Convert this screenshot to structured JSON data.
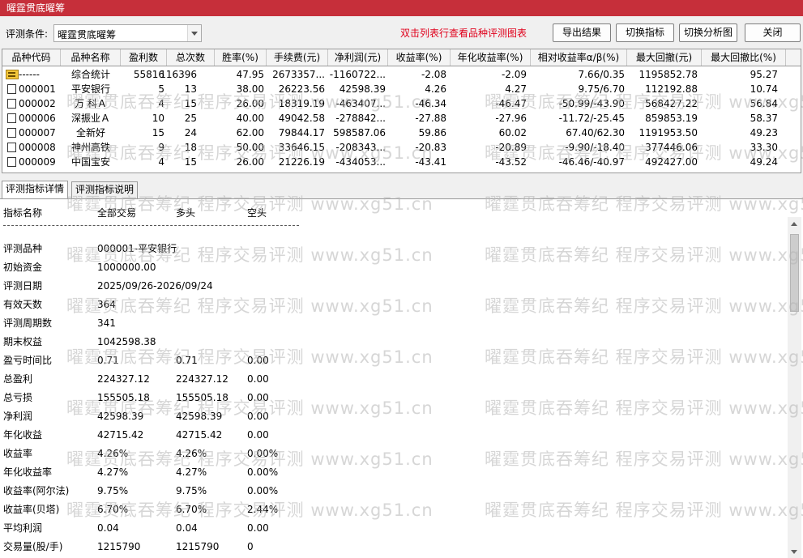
{
  "window": {
    "title": "曜霆贯底曜筹"
  },
  "toolbar": {
    "condition_label": "评测条件:",
    "condition_value": "曜霆贯底曜筹",
    "hint": "双击列表行查看品种评测图表",
    "buttons": {
      "export": "导出结果",
      "switch_indicator": "切换指标",
      "switch_chart": "切换分析图",
      "close": "关闭"
    }
  },
  "table": {
    "columns": [
      "品种代码",
      "品种名称",
      "盈利数",
      "总次数",
      "胜率(%)",
      "手续费(元)",
      "净利润(元)",
      "收益率(%)",
      "年化收益率(%)",
      "相对收益率α/β(%)",
      "最大回撤(元)",
      "最大回撤比(%)"
    ],
    "rows": [
      {
        "code": "------",
        "name": "综合统计",
        "win": "55816",
        "total": "116396",
        "rate": "47.95",
        "fee": "2673357...",
        "profit": "-1160722...",
        "ret": "-2.08",
        "annual": "-2.09",
        "rel": "7.66/0.35",
        "dd": "1195852.78",
        "ddr": "95.27",
        "icon": "folder"
      },
      {
        "code": "000001",
        "name": "平安银行",
        "win": "5",
        "total": "13",
        "rate": "38.00",
        "fee": "26223.56",
        "profit": "42598.39",
        "ret": "4.26",
        "annual": "4.27",
        "rel": "9.75/6.70",
        "dd": "112192.88",
        "ddr": "10.74",
        "icon": "doc"
      },
      {
        "code": "000002",
        "name": "万 科Ａ",
        "win": "4",
        "total": "15",
        "rate": "26.00",
        "fee": "18319.19",
        "profit": "-463407...",
        "ret": "-46.34",
        "annual": "-46.47",
        "rel": "-50.99/-43.90",
        "dd": "568427.22",
        "ddr": "56.84",
        "icon": "doc"
      },
      {
        "code": "000006",
        "name": "深振业Ａ",
        "win": "10",
        "total": "25",
        "rate": "40.00",
        "fee": "49042.58",
        "profit": "-278842...",
        "ret": "-27.88",
        "annual": "-27.96",
        "rel": "-11.72/-25.45",
        "dd": "859853.19",
        "ddr": "58.37",
        "icon": "doc"
      },
      {
        "code": "000007",
        "name": "全新好",
        "win": "15",
        "total": "24",
        "rate": "62.00",
        "fee": "79844.17",
        "profit": "598587.06",
        "ret": "59.86",
        "annual": "60.02",
        "rel": "67.40/62.30",
        "dd": "1191953.50",
        "ddr": "49.23",
        "icon": "doc"
      },
      {
        "code": "000008",
        "name": "神州高铁",
        "win": "9",
        "total": "18",
        "rate": "50.00",
        "fee": "33646.15",
        "profit": "-208343...",
        "ret": "-20.83",
        "annual": "-20.89",
        "rel": "-9.90/-18.40",
        "dd": "377446.06",
        "ddr": "33.30",
        "icon": "doc"
      },
      {
        "code": "000009",
        "name": "中国宝安",
        "win": "4",
        "total": "15",
        "rate": "26.00",
        "fee": "21226.19",
        "profit": "-434053...",
        "ret": "-43.41",
        "annual": "-43.52",
        "rel": "-46.46/-40.97",
        "dd": "492427.00",
        "ddr": "49.24",
        "icon": "doc"
      }
    ]
  },
  "tabs": [
    "评测指标详情",
    "评测指标说明"
  ],
  "detail": {
    "header": {
      "label": "指标名称",
      "v1": "全部交易",
      "v2": "多头",
      "v3": "空头"
    },
    "rows": [
      {
        "label": "评测品种",
        "v1": "000001-平安银行",
        "v2": "",
        "v3": ""
      },
      {
        "label": "初始资金",
        "v1": "1000000.00",
        "v2": "",
        "v3": ""
      },
      {
        "label": "评测日期",
        "v1": "2025/09/26-2026/09/24",
        "v2": "",
        "v3": ""
      },
      {
        "label": "有效天数",
        "v1": "364",
        "v2": "",
        "v3": ""
      },
      {
        "label": "评测周期数",
        "v1": "341",
        "v2": "",
        "v3": ""
      },
      {
        "label": "期末权益",
        "v1": "1042598.38",
        "v2": "",
        "v3": ""
      },
      {
        "label": "盈亏时间比",
        "v1": "0.71",
        "v2": "0.71",
        "v3": "0.00"
      },
      {
        "label": "总盈利",
        "v1": "224327.12",
        "v2": "224327.12",
        "v3": "0.00"
      },
      {
        "label": "总亏损",
        "v1": "155505.18",
        "v2": "155505.18",
        "v3": "0.00"
      },
      {
        "label": "净利润",
        "v1": "42598.39",
        "v2": "42598.39",
        "v3": "0.00"
      },
      {
        "label": "年化收益",
        "v1": "42715.42",
        "v2": "42715.42",
        "v3": "0.00"
      },
      {
        "label": "收益率",
        "v1": "4.26%",
        "v2": "4.26%",
        "v3": "0.00%"
      },
      {
        "label": "年化收益率",
        "v1": "4.27%",
        "v2": "4.27%",
        "v3": "0.00%"
      },
      {
        "label": "收益率(阿尔法)",
        "v1": "9.75%",
        "v2": "9.75%",
        "v3": "0.00%"
      },
      {
        "label": "收益率(贝塔)",
        "v1": "6.70%",
        "v2": "6.70%",
        "v3": "2.44%"
      },
      {
        "label": "平均利润",
        "v1": "0.04",
        "v2": "0.04",
        "v3": "0.00"
      },
      {
        "label": "交易量(股/手)",
        "v1": "1215790",
        "v2": "1215790",
        "v3": "0"
      }
    ]
  },
  "watermark": {
    "text": "曜霆贯底吞筹纪 程序交易评测 www.xg51.cn"
  },
  "colors": {
    "title_bar": "#c62f3a",
    "hint": "#e0001b"
  }
}
